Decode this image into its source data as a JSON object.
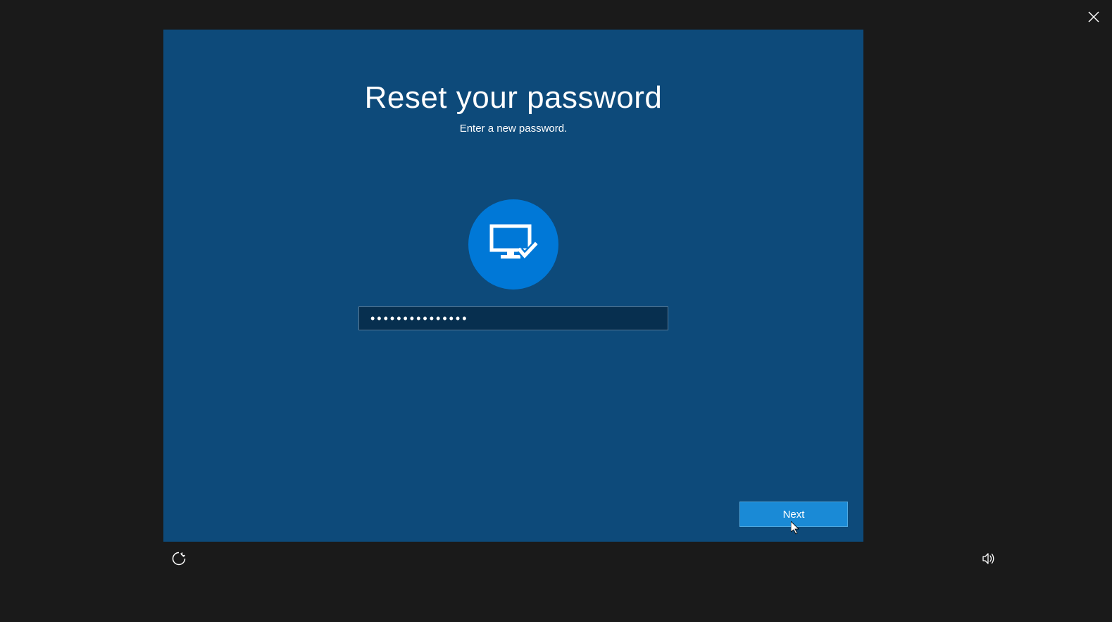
{
  "title": "Reset your password",
  "subtitle": "Enter a new password.",
  "password_value": "•••••••••••••••",
  "next_label": "Next",
  "icons": {
    "close": "close-icon",
    "account_avatar": "monitor-check-icon",
    "ease_of_access": "ease-of-access-icon",
    "volume": "volume-icon"
  },
  "colors": {
    "background": "#1a1a1a",
    "panel": "#0d4a7a",
    "accent": "#0078d7",
    "button": "#1a8ad6",
    "input_bg": "#072f4f"
  }
}
